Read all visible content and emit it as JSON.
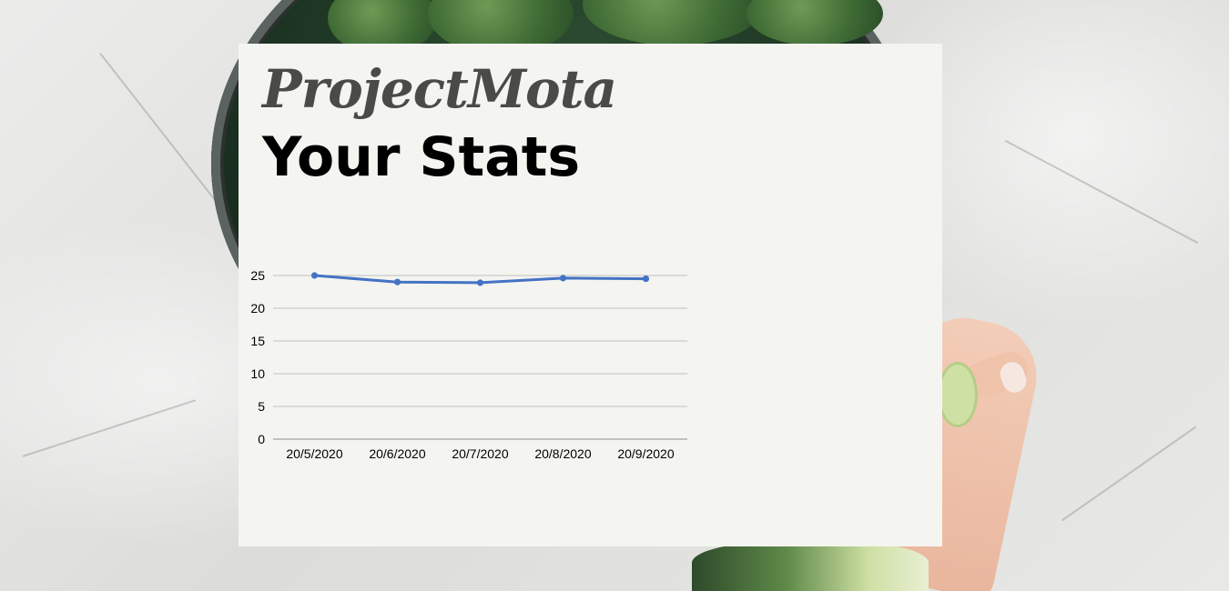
{
  "header": {
    "brand": "ProjectMota",
    "title": "Your Stats"
  },
  "colors": {
    "series": "#4472c4",
    "grid": "#bfbfbf",
    "axis_text": "#000000"
  },
  "chart_data": {
    "type": "line",
    "categories": [
      "20/5/2020",
      "20/6/2020",
      "20/7/2020",
      "20/8/2020",
      "20/9/2020"
    ],
    "series": [
      {
        "values": [
          25,
          24,
          23.9,
          24.6,
          24.5
        ]
      }
    ],
    "ylim": [
      0,
      25
    ],
    "yticks": [
      0,
      5,
      10,
      15,
      20,
      25
    ],
    "grid": true,
    "markers": true,
    "legend": false
  }
}
